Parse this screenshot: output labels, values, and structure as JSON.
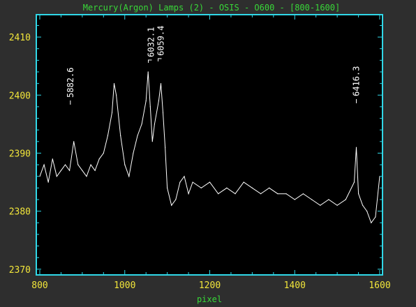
{
  "chart_data": {
    "type": "line",
    "title": "Mercury(Argon) Lamps (2) - OSIS - O600 - [800-1600]",
    "xlabel": "pixel",
    "ylabel": "",
    "xlim": [
      800,
      1600
    ],
    "ylim": [
      2369.5,
      2413.5
    ],
    "x_ticks": [
      800,
      1000,
      1200,
      1400,
      1600
    ],
    "x_tick_labels": [
      "800",
      "1000",
      "1200",
      "1400",
      "1600"
    ],
    "y_ticks": [
      2370,
      2380,
      2390,
      2400,
      2410
    ],
    "y_tick_labels": [
      "2370",
      "2380",
      "2390",
      "2400",
      "2410"
    ],
    "grid": false,
    "series": [
      {
        "name": "",
        "color": "#ffffff",
        "x": [
          800,
          810,
          820,
          830,
          840,
          850,
          860,
          870,
          880,
          890,
          900,
          910,
          920,
          930,
          940,
          950,
          960,
          970,
          975,
          980,
          990,
          1000,
          1010,
          1020,
          1030,
          1040,
          1050,
          1055,
          1060,
          1065,
          1070,
          1080,
          1085,
          1090,
          1095,
          1100,
          1110,
          1120,
          1130,
          1140,
          1150,
          1160,
          1180,
          1200,
          1220,
          1240,
          1260,
          1280,
          1300,
          1320,
          1340,
          1360,
          1380,
          1400,
          1420,
          1440,
          1460,
          1480,
          1500,
          1520,
          1540,
          1545,
          1550,
          1560,
          1570,
          1580,
          1590,
          1600
        ],
        "y": [
          2386,
          2388,
          2385,
          2389,
          2386,
          2387,
          2388,
          2387,
          2392,
          2388,
          2387,
          2386,
          2388,
          2387,
          2389,
          2390,
          2393,
          2397,
          2402,
          2400,
          2393,
          2388,
          2386,
          2390,
          2393,
          2395,
          2399,
          2404,
          2398,
          2392,
          2395,
          2399,
          2402,
          2397,
          2391,
          2384,
          2381,
          2382,
          2385,
          2386,
          2383,
          2385,
          2384,
          2385,
          2383,
          2384,
          2383,
          2385,
          2384,
          2383,
          2384,
          2383,
          2383,
          2382,
          2383,
          2382,
          2381,
          2382,
          2381,
          2382,
          2385,
          2391,
          2383,
          2381,
          2380,
          2378,
          2379,
          2386
        ]
      }
    ],
    "annotations": [
      {
        "x": 872,
        "label": "5882.6",
        "bracket": false
      },
      {
        "x": 1062,
        "label": "6032.1",
        "bracket": true
      },
      {
        "x": 1085,
        "label": "6059.4",
        "bracket": true
      },
      {
        "x": 1545,
        "label": "6416.3",
        "bracket": false
      }
    ]
  }
}
